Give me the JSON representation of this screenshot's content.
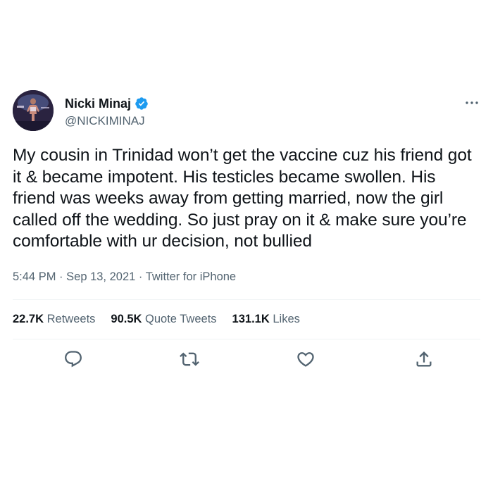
{
  "user": {
    "display_name": "Nicki Minaj",
    "handle": "@NICKIMINAJ",
    "verified": true
  },
  "tweet": {
    "text": "My cousin in Trinidad won’t get the vaccine cuz his friend got it & became impotent. His testicles became swollen. His friend was weeks away from getting married, now the girl called off the wedding. So just pray on it & make sure you’re comfortable with ur decision, not bullied",
    "time": "5:44 PM",
    "date": "Sep 13, 2021",
    "separator": "·",
    "source": "Twitter for iPhone"
  },
  "stats": {
    "retweets_count": "22.7K",
    "retweets_label": "Retweets",
    "quotes_count": "90.5K",
    "quotes_label": "Quote Tweets",
    "likes_count": "131.1K",
    "likes_label": "Likes"
  },
  "icons": {
    "verified": "verified-badge-icon",
    "more": "more-options-icon",
    "reply": "reply-icon",
    "retweet": "retweet-icon",
    "like": "heart-icon",
    "share": "share-icon"
  },
  "colors": {
    "text": "#0f1419",
    "secondary": "#536471",
    "verified": "#1d9bf0",
    "divider": "#eff3f4"
  }
}
